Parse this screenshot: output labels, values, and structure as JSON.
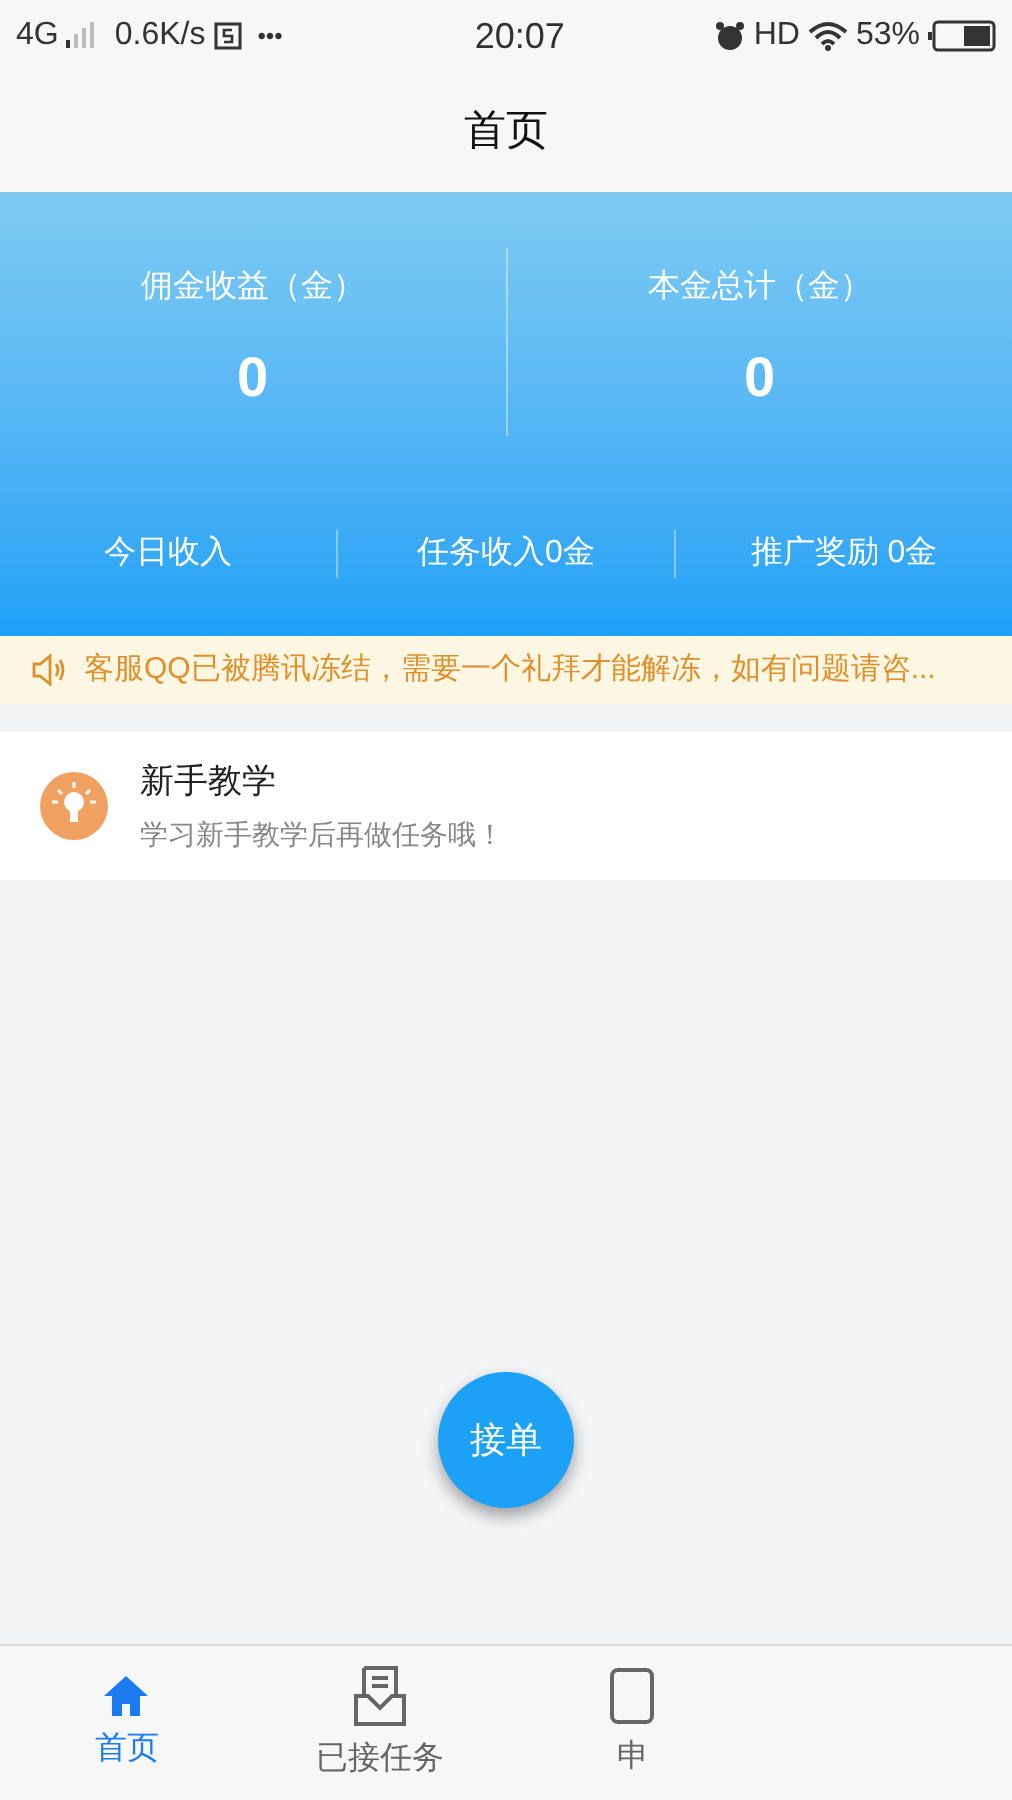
{
  "status_bar": {
    "network": "4G",
    "speed": "0.6K/s",
    "more": "•••",
    "time": "20:07",
    "hd": "HD",
    "battery": "53%"
  },
  "header": {
    "title": "首页"
  },
  "stats": [
    {
      "label": "佣金收益（金）",
      "value": "0"
    },
    {
      "label": "本金总计（金）",
      "value": "0"
    }
  ],
  "summary": [
    "今日收入",
    "任务收入0金",
    "推广奖励 0金"
  ],
  "notice": "客服QQ已被腾讯冻结，需要一个礼拜才能解冻，如有问题请咨...",
  "tutorial": {
    "title": "新手教学",
    "subtitle": "学习新手教学后再做任务哦！"
  },
  "fab": "接单",
  "tabs": [
    {
      "label": "首页",
      "selected": true,
      "kind": "home"
    },
    {
      "label": "已接任务",
      "selected": false,
      "kind": "inbox"
    },
    {
      "label": "申",
      "selected": false,
      "kind": "apply"
    }
  ]
}
